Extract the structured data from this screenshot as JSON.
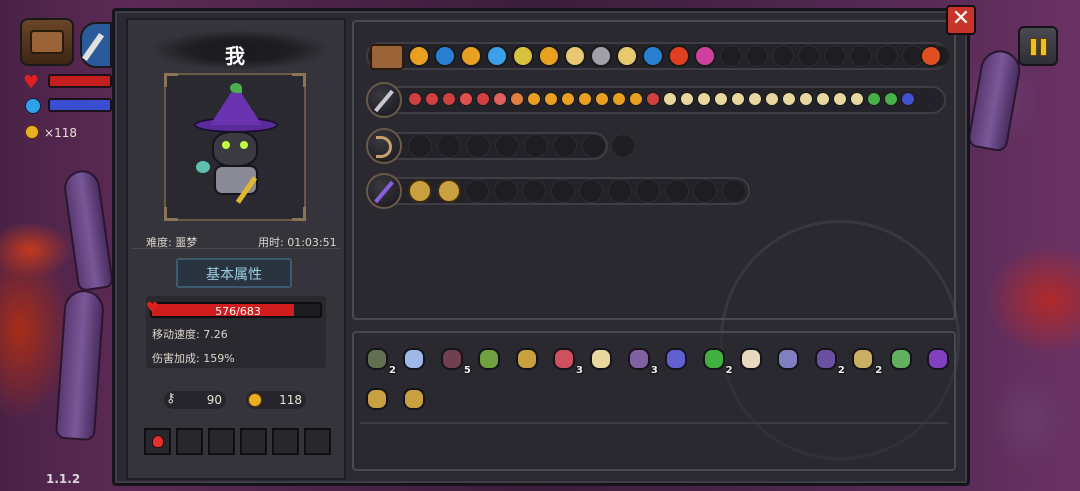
{
  "hud": {
    "coins_prefix": "×",
    "coins": "118",
    "version": "1.1.2"
  },
  "character": {
    "name": "我",
    "difficulty_label": "难度: 噩梦",
    "time_label": "用时: 01:03:51",
    "section_title": "基本属性",
    "hp_current": 576,
    "hp_max": 683,
    "hp_text": "576/683",
    "move_speed_label": "移动速度: 7.26",
    "damage_bonus_label": "伤害加成: 159%",
    "keys": "90",
    "gold": "118"
  },
  "buttons": {
    "close": "✕"
  },
  "items": [
    {
      "icon": "skull-mask-icon",
      "count": "2"
    },
    {
      "icon": "lotus-icon",
      "count": ""
    },
    {
      "icon": "cloak-icon",
      "count": "5"
    },
    {
      "icon": "leaf-sprout-icon",
      "count": ""
    },
    {
      "icon": "scroll-box-icon",
      "count": ""
    },
    {
      "icon": "potion-sack-icon",
      "count": "3"
    },
    {
      "icon": "bread-loaf-icon",
      "count": ""
    },
    {
      "icon": "envelope-icon",
      "count": "3"
    },
    {
      "icon": "water-drop-icon",
      "count": ""
    },
    {
      "icon": "clover-icon",
      "count": "2"
    },
    {
      "icon": "feather-icon",
      "count": ""
    },
    {
      "icon": "small-flask-icon",
      "count": ""
    },
    {
      "icon": "robe-icon",
      "count": "2"
    },
    {
      "icon": "magnifier-icon",
      "count": "2"
    },
    {
      "icon": "syringe-icon",
      "count": ""
    },
    {
      "icon": "wizard-hat-icon",
      "count": ""
    },
    {
      "icon": "hook-icon",
      "count": ""
    },
    {
      "icon": "pickaxe-icon",
      "count": ""
    }
  ]
}
